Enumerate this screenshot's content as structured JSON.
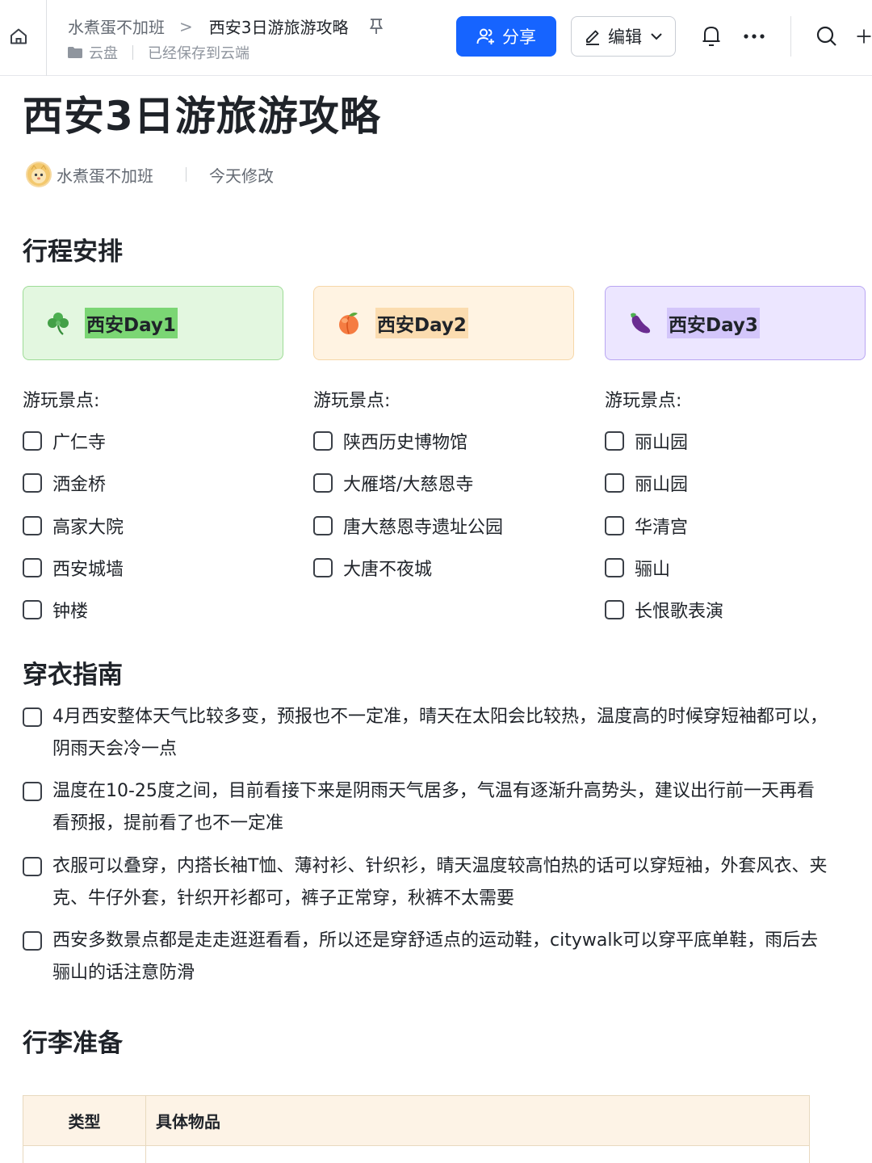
{
  "header": {
    "breadcrumb_parent": "水煮蛋不加班",
    "breadcrumb_separator": ">",
    "breadcrumb_current": "西安3日游旅游攻略",
    "location": "云盘",
    "save_status": "已经保存到云端",
    "share_label": "分享",
    "edit_label": "编辑",
    "more_label": "···",
    "accent_color": "#1664ff"
  },
  "doc": {
    "title": "西安3日游旅游攻略",
    "author": "水煮蛋不加班",
    "modified": "今天修改"
  },
  "itinerary": {
    "heading": "行程安排",
    "days": [
      {
        "label": "西安Day1",
        "icon": "clover-icon",
        "color": "#e3f7e0"
      },
      {
        "label": "西安Day2",
        "icon": "peach-icon",
        "color": "#fff3e2"
      },
      {
        "label": "西安Day3",
        "icon": "eggplant-icon",
        "color": "#ece6ff"
      }
    ],
    "spots_label": "游玩景点:",
    "day1_spots": [
      "广仁寺",
      "洒金桥",
      "高家大院",
      "西安城墙",
      "钟楼"
    ],
    "day2_spots": [
      "陕西历史博物馆",
      "大雁塔/大慈恩寺",
      "唐大慈恩寺遗址公园",
      "大唐不夜城"
    ],
    "day3_spots": [
      "丽山园",
      "丽山园",
      "华清宫",
      "骊山",
      "长恨歌表演"
    ]
  },
  "clothing": {
    "heading": "穿衣指南",
    "items": [
      "4月西安整体天气比较多变，预报也不一定准，晴天在太阳会比较热，温度高的时候穿短袖都可以，阴雨天会冷一点",
      "温度在10-25度之间，目前看接下来是阴雨天气居多，气温有逐渐升高势头，建议出行前一天再看看预报，提前看了也不一定准",
      "衣服可以叠穿，内搭长袖T恤、薄衬衫、针织衫，晴天温度较高怕热的话可以穿短袖，外套风衣、夹克、牛仔外套，针织开衫都可，裤子正常穿，秋裤不太需要",
      "西安多数景点都是走走逛逛看看，所以还是穿舒适点的运动鞋，citywalk可以穿平底单鞋，雨后去骊山的话注意防滑"
    ]
  },
  "luggage": {
    "heading": "行李准备",
    "col_type": "类型",
    "col_items": "具体物品"
  }
}
